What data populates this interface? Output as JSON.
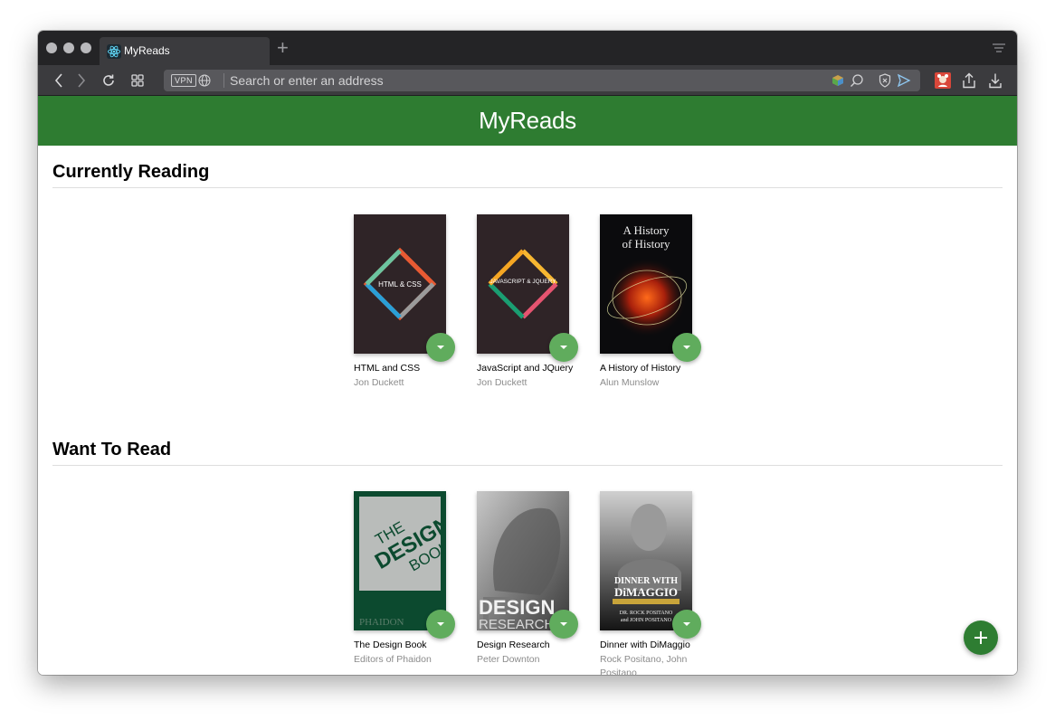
{
  "browser": {
    "tab_title": "MyReads",
    "new_tab_label": "+",
    "vpn_label": "VPN",
    "address_placeholder": "Search or enter an address",
    "icons": [
      "back-icon",
      "forward-icon",
      "reload-icon",
      "speed-dial-icon",
      "globe-icon",
      "extension-icon",
      "search-lens-icon",
      "shield-icon",
      "send-icon",
      "profile-icon",
      "share-icon",
      "download-icon"
    ]
  },
  "app": {
    "title": "MyReads",
    "accent_color": "#2e7c31",
    "changer_color": "#60ac5d"
  },
  "shelves": [
    {
      "title": "Currently Reading",
      "books": [
        {
          "title": "HTML and CSS",
          "author": "Jon Duckett",
          "cover_text": "HTML & CSS"
        },
        {
          "title": "JavaScript and JQuery",
          "author": "Jon Duckett",
          "cover_text": "JAVASCRIPT & JQUERY"
        },
        {
          "title": "A History of History",
          "author": "Alun Munslow",
          "cover_text": "A History of History"
        }
      ]
    },
    {
      "title": "Want To Read",
      "books": [
        {
          "title": "The Design Book",
          "author": "Editors of Phaidon",
          "cover_text": "THE DESIGN BOOK"
        },
        {
          "title": "Design Research",
          "author": "Peter Downton",
          "cover_text": "DESIGN RESEARCH"
        },
        {
          "title": "Dinner with DiMaggio",
          "author": "Rock Positano, John Positano",
          "cover_text": "DINNER WITH DiMAGGIO"
        }
      ]
    }
  ],
  "fab_label": "+"
}
